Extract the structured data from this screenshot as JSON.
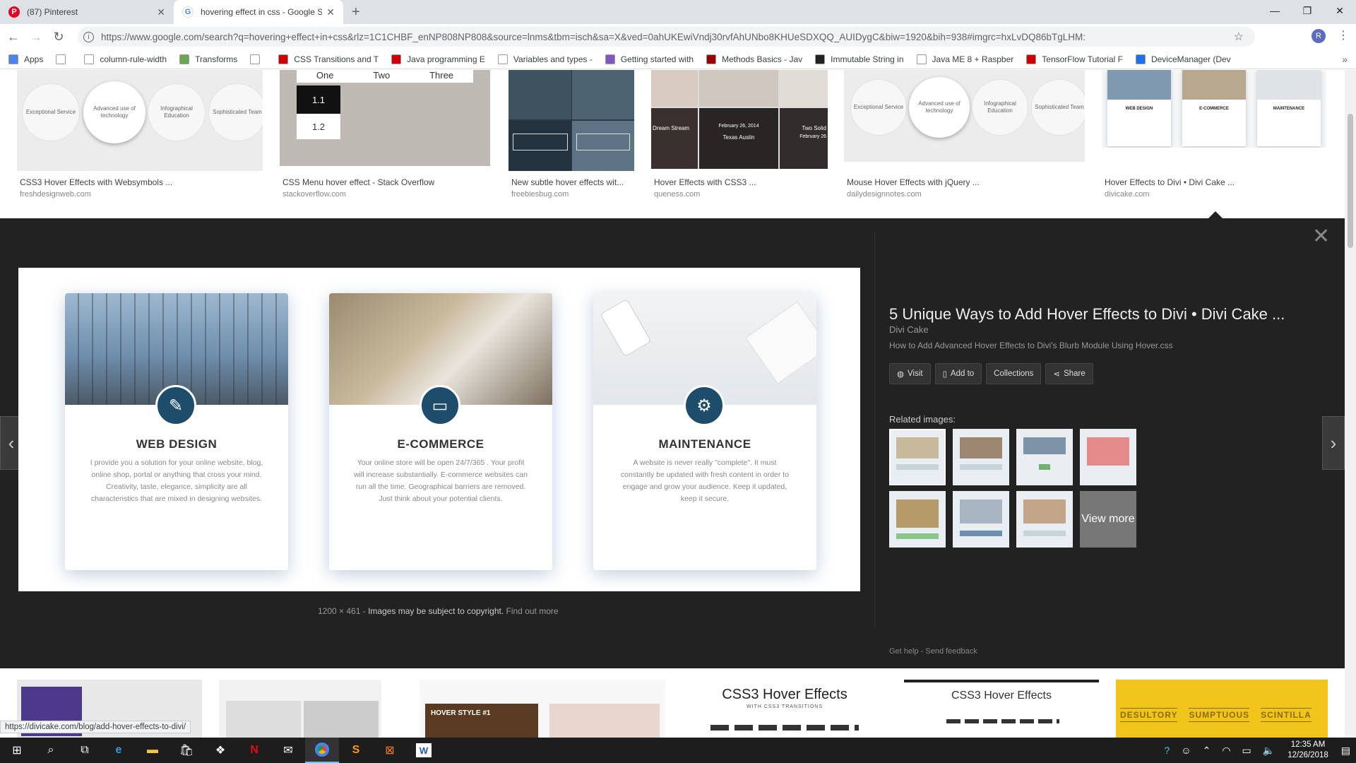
{
  "tabs": [
    {
      "label": "(87) Pinterest",
      "icon": "pinterest-icon",
      "color": "#e60023"
    },
    {
      "label": "hovering effect in css - Google Se",
      "icon": "google-icon",
      "color": "#4285f4"
    }
  ],
  "toolbar": {
    "url": "https://www.google.com/search?q=hovering+effect+in+css&rlz=1C1CHBF_enNP808NP808&source=lnms&tbm=isch&sa=X&ved=0ahUKEwiVndj30rvfAhUNbo8KHUeSDXQQ_AUIDygC&biw=1920&bih=938#imgrc=hxLvDQ86bTgLHM:",
    "avatar": "R"
  },
  "bookmarks": [
    {
      "label": "Apps",
      "icon": "apps-grid-icon",
      "color": "#4a86e8"
    },
    {
      "label": "",
      "icon": "page-icon",
      "color": "#ffffff"
    },
    {
      "label": "column-rule-width",
      "icon": "page-icon",
      "color": "#ffffff"
    },
    {
      "label": "Transforms",
      "icon": "codrops-icon",
      "color": "#6aa84f"
    },
    {
      "label": "",
      "icon": "page-icon",
      "color": "#ffffff"
    },
    {
      "label": "CSS Transitions and T",
      "icon": "bookmark-icon",
      "color": "#cc0000"
    },
    {
      "label": "Java programming E",
      "icon": "java-icon",
      "color": "#cc0000"
    },
    {
      "label": "Variables and types -",
      "icon": "page-icon",
      "color": "#ffffff"
    },
    {
      "label": "Getting started with",
      "icon": "planet-icon",
      "color": "#7e57c2"
    },
    {
      "label": "Methods Basics - Jav",
      "icon": "ruby-icon",
      "color": "#990000"
    },
    {
      "label": "Immutable String in",
      "icon": "sf-icon",
      "color": "#222222"
    },
    {
      "label": "Java ME 8 + Raspber",
      "icon": "t-icon",
      "color": "#ffffff"
    },
    {
      "label": "TensorFlow Tutorial F",
      "icon": "oracle-icon",
      "color": "#cc0000"
    },
    {
      "label": "DeviceManager (Dev",
      "icon": "shield-icon",
      "color": "#1a73e8"
    }
  ],
  "results_top": [
    {
      "title": "CSS3 Hover Effects with Websymbols ...",
      "source": "freshdesignweb.com"
    },
    {
      "title": "CSS Menu hover effect - Stack Overflow",
      "source": "stackoverflow.com"
    },
    {
      "title": "New subtle hover effects wit...",
      "source": "freebiesbug.com"
    },
    {
      "title": "Hover Effects with CSS3 ...",
      "source": "queness.com"
    },
    {
      "title": "Mouse Hover Effects with jQuery ...",
      "source": "dailydesignnotes.com"
    },
    {
      "title": "Hover Effects to Divi • Divi Cake ...",
      "source": "divicake.com"
    }
  ],
  "circles1": [
    "Exceptional Service",
    "Advanced use of technology",
    "Infographical Education",
    "Sophisticated Team"
  ],
  "menu_thumb": {
    "cols": [
      "One",
      "Two",
      "Three"
    ],
    "items": [
      "1.1",
      "1.2"
    ]
  },
  "queness_thumb": [
    "Dream Stream",
    "February 26, 2014",
    "Texas Austin",
    "Two Solid",
    "February 26"
  ],
  "circles2": [
    "Exceptional Service",
    "Advanced use of technology",
    "Infographical Education",
    "Sophisticated Team"
  ],
  "divi_thumb": [
    "WEB DESIGN",
    "E-COMMERCE",
    "MAINTENANCE"
  ],
  "panel": {
    "cards": [
      {
        "title": "WEB DESIGN",
        "text": "I provide you a solution for your online website, blog, online shop, portal or anything that cross your mind. Creativity, taste, elegance, simplicity are all characteristics that are mixed in designing websites.",
        "icon": "brush-icon"
      },
      {
        "title": "E-COMMERCE",
        "text": "Your online store will be open 24/7/365 . Your profit will increase substantially. E-commerce websites can run all the time. Geographical barriers are removed. Just think about your potential clients.",
        "icon": "credit-card-icon"
      },
      {
        "title": "MAINTENANCE",
        "text": "A website is never really \"complete\". It must constantly be updated with fresh content in order to engage and grow your audience. Keep it updated, keep it secure.",
        "icon": "gear-icon"
      }
    ],
    "dimensions": "1200 × 461",
    "copyright": "Images may be subject to copyright.",
    "find_out_more": "Find out more",
    "title": "5 Unique Ways to Add Hover Effects to Divi • Divi Cake ...",
    "site": "Divi Cake",
    "description": "How to Add Advanced Hover Effects to Divi's Blurb Module Using Hover.css",
    "buttons": {
      "visit": "Visit",
      "add_to": "Add to",
      "collections": "Collections",
      "share": "Share"
    },
    "related_label": "Related images:",
    "view_more": "View more",
    "get_help": "Get help",
    "send_feedback": "Send feedback"
  },
  "bottom_thumbs": {
    "hover_style": "HOVER STYLE #1",
    "css3_a": "CSS3 Hover Effects",
    "css3_a_sub": "WITH CSS3 TRANSITIONS",
    "css3_b": "CSS3 Hover Effects",
    "words": [
      "DESULTORY",
      "SUMPTUOUS",
      "SCINTILLA"
    ]
  },
  "status_url": "https://divicake.com/blog/add-hover-effects-to-divi/",
  "clock": {
    "time": "12:35 AM",
    "date": "12/26/2018"
  },
  "colors": {
    "panel_bg": "#222222",
    "divi_icon": "#1d4d6b",
    "yellow": "#f0c419"
  }
}
